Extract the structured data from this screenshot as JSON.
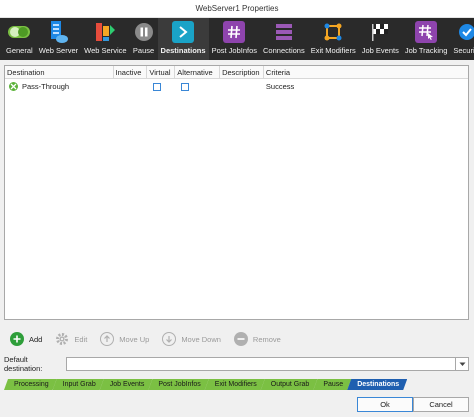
{
  "window": {
    "title": "WebServer1 Properties"
  },
  "toolbar": {
    "items": [
      {
        "label": "General",
        "icon": "toggle-icon",
        "color": "#7bc043"
      },
      {
        "label": "Web Server",
        "icon": "server-icon",
        "color": "#1e88e5"
      },
      {
        "label": "Web Service",
        "icon": "web-service-icon",
        "color": "#f5a623"
      },
      {
        "label": "Pause",
        "icon": "pause-icon",
        "color": "#8a8a8a"
      },
      {
        "label": "Destinations",
        "icon": "arrow-right-icon",
        "color": "#1aa3c7"
      },
      {
        "label": "Post JobInfos",
        "icon": "hash-icon",
        "color": "#8e44ad"
      },
      {
        "label": "Connections",
        "icon": "stack-icon",
        "color": "#9b59b6"
      },
      {
        "label": "Exit Modifiers",
        "icon": "exit-modifier-icon",
        "color": "#f5a623"
      },
      {
        "label": "Job Events",
        "icon": "checkered-flag-icon",
        "color": "#ffffff"
      },
      {
        "label": "Job Tracking",
        "icon": "hash-cursor-icon",
        "color": "#8e44ad"
      },
      {
        "label": "Security",
        "icon": "security-icon",
        "color": "#1e88e5"
      }
    ],
    "active_index": 4
  },
  "grid": {
    "columns": [
      "Destination",
      "Inactive",
      "Virtual",
      "Alternative",
      "Description",
      "Criteria"
    ],
    "rows": [
      {
        "destination": "Pass-Through",
        "inactive": false,
        "virtual": false,
        "alternative": false,
        "description": "",
        "criteria": "Success"
      }
    ]
  },
  "actions": {
    "add": "Add",
    "edit": "Edit",
    "move_up": "Move Up",
    "move_down": "Move Down",
    "remove": "Remove"
  },
  "default_destination": {
    "label": "Default destination:",
    "value": ""
  },
  "tabs": {
    "items": [
      "Processing",
      "Input Grab",
      "Job Events",
      "Post JobInfos",
      "Exit Modifiers",
      "Output Grab",
      "Pause",
      "Destinations"
    ],
    "active_index": 7
  },
  "footer": {
    "ok": "Ok",
    "cancel": "Cancel"
  },
  "colors": {
    "accent": "#1f5fb0",
    "tab_green": "#7bc043",
    "toolbar_bg": "#2a2a2a"
  }
}
